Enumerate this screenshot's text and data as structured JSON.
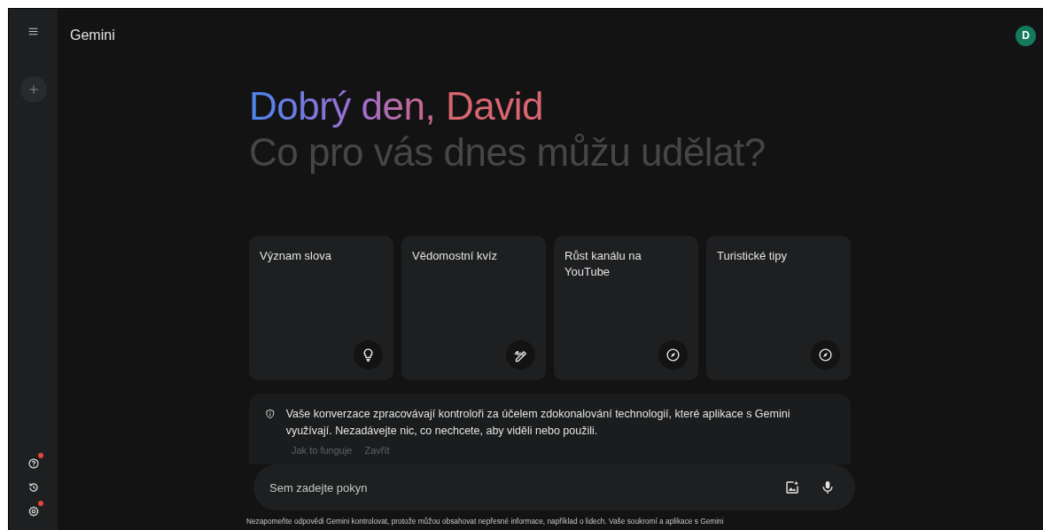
{
  "header": {
    "title": "Gemini",
    "avatar": "D"
  },
  "sidebar": {
    "top": [
      {
        "kind": "menu"
      },
      {
        "kind": "new"
      }
    ],
    "bottom": [
      {
        "kind": "help",
        "badge": true
      },
      {
        "kind": "history",
        "badge": false
      },
      {
        "kind": "settings",
        "badge": true
      }
    ]
  },
  "greeting": {
    "title": "Dobrý den, David",
    "subtitle": "Co pro vás dnes můžu udělat?"
  },
  "cards": [
    {
      "label": "Význam slova",
      "kind": "bulb"
    },
    {
      "label": "Vědomostní kvíz",
      "kind": "pen"
    },
    {
      "label": "Růst kanálu na YouTube",
      "kind": "compass"
    },
    {
      "label": "Turistické tipy",
      "kind": "compass"
    }
  ],
  "notice": {
    "text": "Vaše konverzace zpracovávají kontroloři za účelem zdokonalování technologií, které aplikace s Gemini využívají. Nezadávejte nic, co nechcete, aby viděli nebo použili.",
    "links": [
      "Jak to funguje",
      "Zavřít"
    ]
  },
  "prompt": {
    "placeholder": "Sem zadejte pokyn"
  },
  "footer": "Nezapomeňte odpovědi Gemini kontrolovat, protože můžou obsahovat nepřesné informace, například o lidech. Vaše soukromí a aplikace s Gemini"
}
